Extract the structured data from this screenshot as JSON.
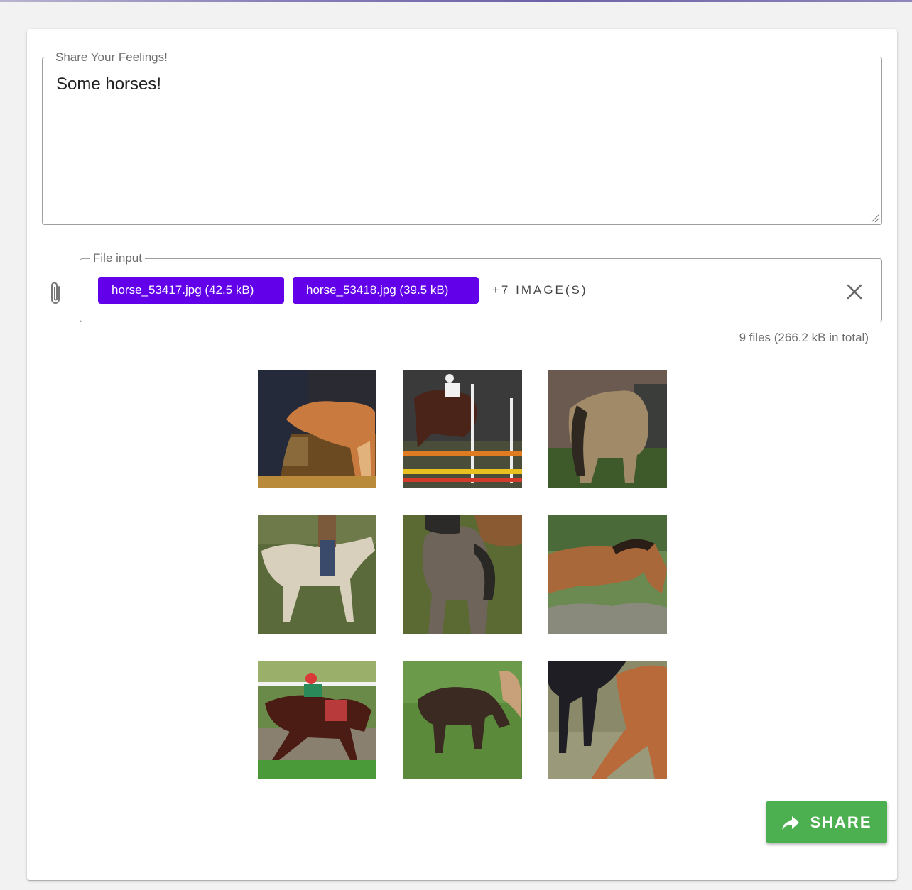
{
  "post": {
    "legend": "Share Your Feelings!",
    "text": "Some horses!"
  },
  "file_input": {
    "legend": "File input",
    "chips": [
      {
        "label": "horse_53417.jpg (42.5 kB)"
      },
      {
        "label": "horse_53418.jpg (39.5 kB)"
      }
    ],
    "more_label": "+7 IMAGE(S)",
    "counter": "9 files (266.2 kB in total)",
    "icons": {
      "attach": "paperclip-icon",
      "clear": "close-icon"
    }
  },
  "gallery": {
    "images": [
      {
        "name": "foal-nursing-image"
      },
      {
        "name": "show-jumping-image"
      },
      {
        "name": "dun-horse-rear-image"
      },
      {
        "name": "grey-horse-rider-image"
      },
      {
        "name": "foal-pasture-image"
      },
      {
        "name": "bay-horse-wall-image"
      },
      {
        "name": "racehorse-jockey-image"
      },
      {
        "name": "pony-grazing-image"
      },
      {
        "name": "chestnut-foal-image"
      }
    ]
  },
  "actions": {
    "share_label": "SHARE",
    "share_icon": "share-arrow-icon"
  },
  "colors": {
    "chip": "#6200ea",
    "share": "#4caf50",
    "outline": "#9e9e9e"
  }
}
